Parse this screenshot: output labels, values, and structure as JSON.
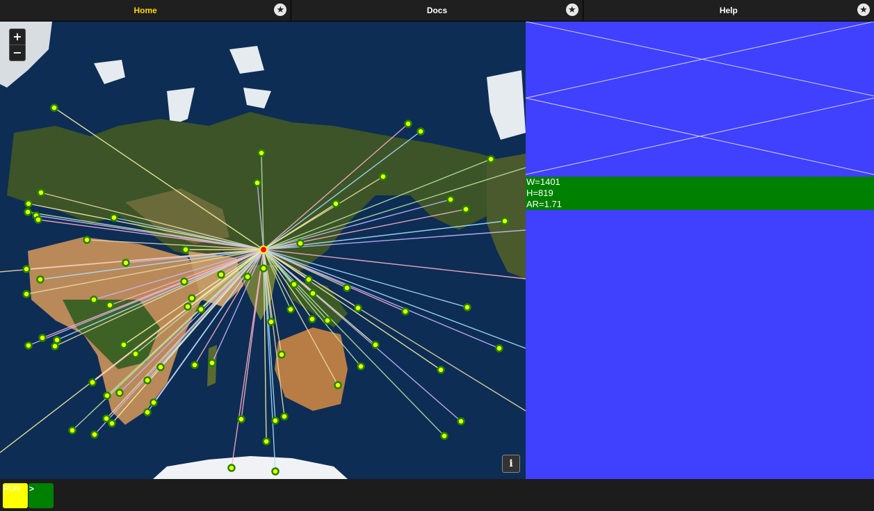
{
  "tabs": [
    {
      "label": "Home",
      "active": true
    },
    {
      "label": "Docs",
      "active": false
    },
    {
      "label": "Help",
      "active": false
    }
  ],
  "icons": {
    "favorite": "star-icon",
    "zoom_in": "plus-icon",
    "zoom_out": "minus-icon",
    "info": "info-icon"
  },
  "map": {
    "zoom_in_label": "+",
    "zoom_out_label": "−",
    "info_label": "i"
  },
  "panel": {
    "width_text": "W=1401",
    "height_text": "H=819",
    "aspect_text": "AR=1.71"
  },
  "console": {
    "run_label": "RUN",
    "prompt_label": ">"
  },
  "colors": {
    "accent_active_tab": "#ffd700",
    "panel_background": "#4040ff",
    "readout_background": "#008000",
    "run_button": "#ffff00",
    "marker_fill": "#ffff00",
    "marker_stroke": "#1a8a00",
    "hub_marker": "#ff0000"
  }
}
